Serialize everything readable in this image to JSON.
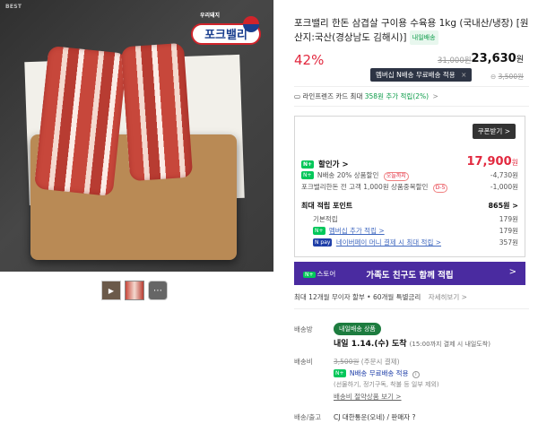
{
  "gallery": {
    "best_tag": "BEST",
    "logo_sub": "우리돼지",
    "logo_text": "포크밸리",
    "thumbs": [
      "video",
      "meat",
      "more"
    ]
  },
  "product": {
    "title": "포크밸리 한돈 삼겹살 구이용 수육용 1kg (국내산/냉장) [원산지:국산(경상남도 김해시)]",
    "fresh_badge": "내일배송",
    "discount_rate": "42%",
    "original_price": "31,000원",
    "final_price": "23,630",
    "won": "원",
    "member_tip": "멤버십 N배송 무료배송 적용",
    "member_tip_close": "×",
    "member_old_prefix": "⊖",
    "member_old_price": "3,500원",
    "card_text": "라인프렌즈 카드 최대",
    "card_highlight": "358원 추가 적립(2%)",
    "card_arrow": ">"
  },
  "benefit": {
    "coupon_button": "쿠폰받기 >",
    "sale_label": "할인가 >",
    "sale_price": "17,900",
    "won": "원",
    "discounts": [
      {
        "label": "N배송 20% 상품할인",
        "tag": "오늘까지",
        "value": "-4,730원"
      },
      {
        "label": "포크밸리한돈 전 고객 1,000원 상품중복할인",
        "tag": "D-5",
        "value": "-1,000원"
      }
    ],
    "point_label": "최대 적립 포인트",
    "point_value": "865원 >",
    "points": [
      {
        "label": "기본적립",
        "value": "179원"
      },
      {
        "label": "멤버십 추가 적립 >",
        "value": "179원"
      },
      {
        "label": "네이버페이 머니 결제 시 최대 적립 >",
        "value": "357원"
      }
    ],
    "badge_n": "N+",
    "badge_pay": "N pay"
  },
  "promo": {
    "store_label": "스토어",
    "message": "가족도 친구도 함께 적립",
    "chevron": ">"
  },
  "installment": {
    "text": "최대 12개월 무이자 할부 • 60개월 특별금리",
    "more": "자세히보기 >"
  },
  "shipping": {
    "method_label": "배송방",
    "method_badge": "내일배송 상품",
    "arrive_main": "내일 1.14.(수) 도착",
    "arrive_sub": "(15:00까지 결제 시 내일도착)",
    "fee_label": "배송비",
    "fee_old": "3,500원",
    "fee_sub": "(주문시 결제)",
    "free_text": "N배송 무료배송 적용",
    "sub_note": "(선물하기, 정기구독, 착불 등 일부 제외)",
    "save_link": "배송비 절약상품 보기 >",
    "courier_label": "배송/출고",
    "courier_value": "CJ 대한통운(오네) / 판매자 ?"
  }
}
